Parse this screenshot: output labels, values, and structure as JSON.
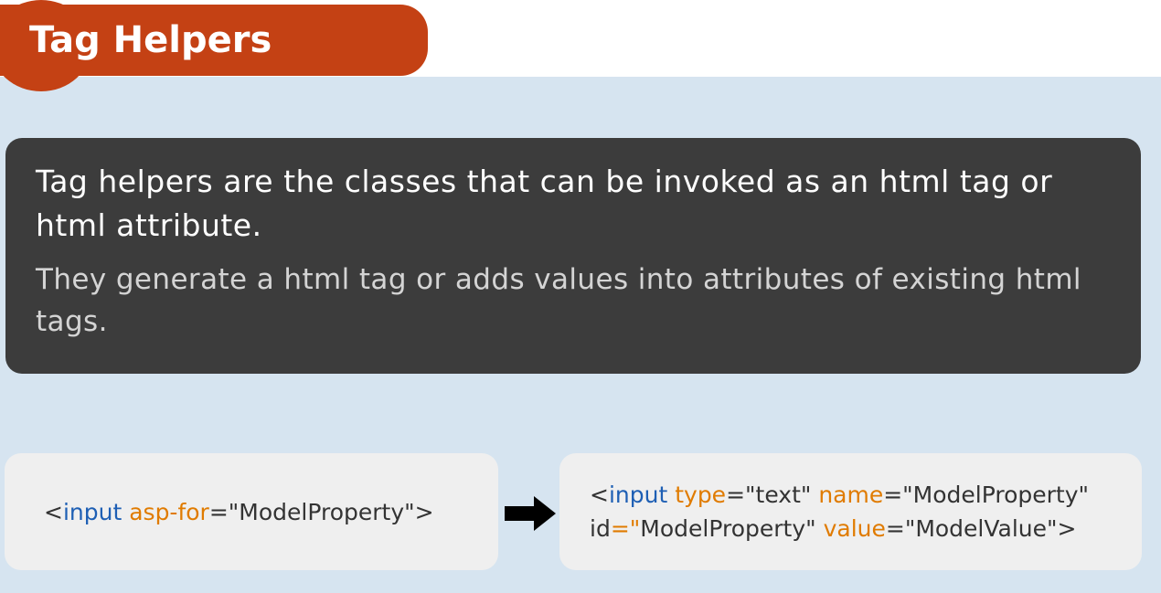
{
  "slide": {
    "title": "Tag Helpers",
    "definition": {
      "primary": "Tag helpers are the classes that can be invoked as an html tag or html attribute.",
      "secondary": "They generate a html tag or adds values into attributes of existing html tags."
    },
    "colors": {
      "title_bar": "#c44114",
      "background": "#d6e4f0",
      "definition_card": "#3c3c3c",
      "code_card": "#efefef",
      "code_tag": "#1e5fb4",
      "code_attribute": "#e07b00"
    },
    "code_before": {
      "tokens": [
        {
          "text": "<",
          "kind": "dark"
        },
        {
          "text": "input",
          "kind": "blue"
        },
        {
          "text": " ",
          "kind": "dark"
        },
        {
          "text": "asp-for",
          "kind": "orange"
        },
        {
          "text": "=",
          "kind": "dark"
        },
        {
          "text": "\"ModelProperty\">",
          "kind": "dark"
        }
      ]
    },
    "arrow_icon": "right-arrow-icon",
    "code_after": {
      "lines": [
        [
          {
            "text": "<",
            "kind": "dark"
          },
          {
            "text": "input",
            "kind": "blue"
          },
          {
            "text": " ",
            "kind": "dark"
          },
          {
            "text": "type",
            "kind": "orange"
          },
          {
            "text": "=\"text\" ",
            "kind": "dark"
          },
          {
            "text": "name",
            "kind": "orange"
          },
          {
            "text": "=\"ModelProperty\"",
            "kind": "dark"
          }
        ],
        [
          {
            "text": "id",
            "kind": "dark"
          },
          {
            "text": "=\"",
            "kind": "orange"
          },
          {
            "text": "ModelProperty\" ",
            "kind": "dark"
          },
          {
            "text": "value",
            "kind": "orange"
          },
          {
            "text": "=\"ModelValue\">",
            "kind": "dark"
          }
        ]
      ]
    }
  }
}
